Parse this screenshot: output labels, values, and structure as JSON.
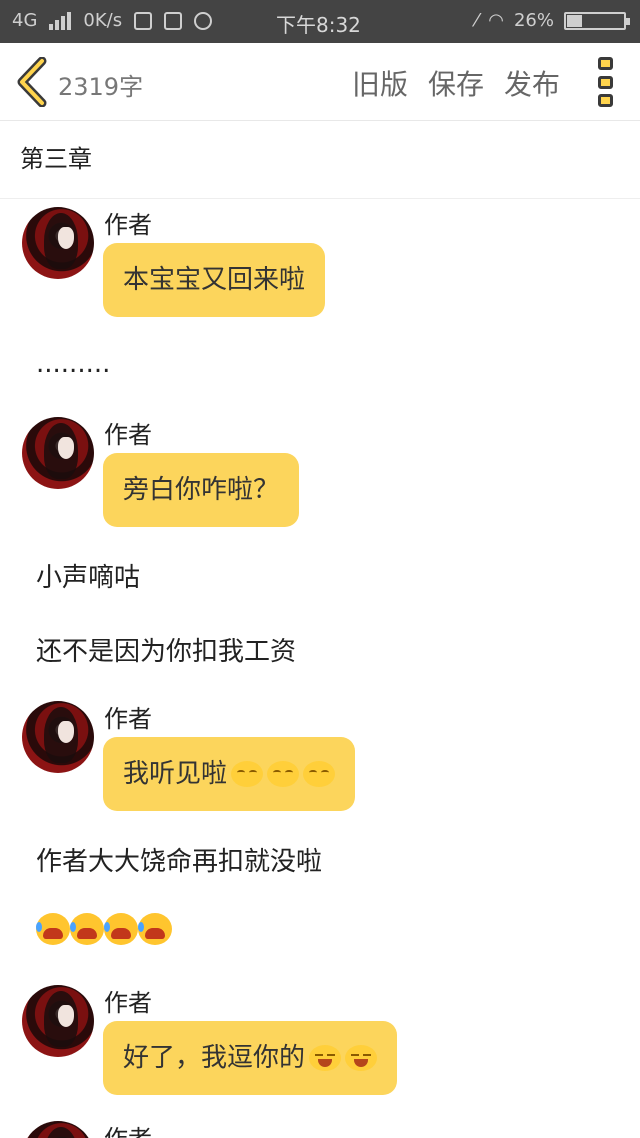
{
  "status_bar": {
    "left_text": "4G",
    "speed": "0K/s",
    "time": "下午8:32",
    "battery": "26%",
    "battery_level_percent": 26
  },
  "header": {
    "word_count": "2319字",
    "actions": [
      "旧版",
      "保存",
      "发布"
    ]
  },
  "chapter": {
    "title": "第三章"
  },
  "messages": [
    {
      "sender": "作者",
      "text": "本宝宝又回来啦",
      "emoji": []
    },
    {
      "sender": "作者",
      "text": "旁白你咋啦？",
      "emoji": []
    },
    {
      "sender": "作者",
      "text": "我听见啦",
      "emoji": [
        "smile",
        "smile",
        "smile"
      ]
    },
    {
      "sender": "作者",
      "text": "好了，我逗你的",
      "emoji": [
        "laugh",
        "laugh"
      ]
    },
    {
      "sender": "作者"
    }
  ],
  "paragraphs": {
    "dots": ".........",
    "p1": "小声嘀咕",
    "p2": "还不是因为你扣我工资",
    "p3": "作者大大饶命再扣就没啦",
    "crying_emoji_count": 4
  }
}
